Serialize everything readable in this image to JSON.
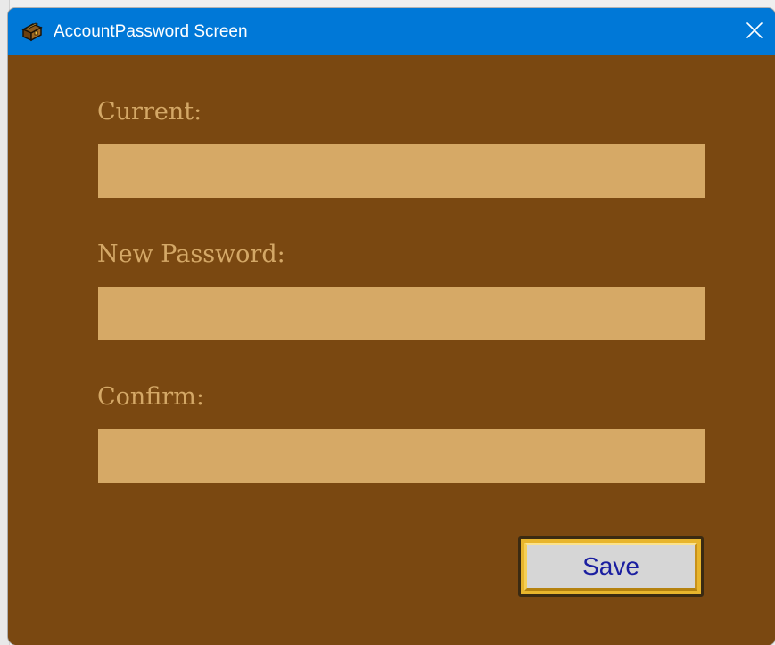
{
  "window": {
    "title": "AccountPassword Screen",
    "icon": "treasure-chest-icon",
    "close_icon": "close-icon"
  },
  "form": {
    "current_label": "Current:",
    "current_value": "",
    "new_password_label": "New Password:",
    "new_password_value": "",
    "confirm_label": "Confirm:",
    "confirm_value": "",
    "save_label": "Save"
  },
  "colors": {
    "titlebar": "#0078d7",
    "background": "#7a4811",
    "label_text": "#d4a867",
    "input_fill": "#d6a966",
    "button_frame": "#e8b52c",
    "button_face": "#d6d6d6",
    "button_text": "#1a1ea0"
  }
}
